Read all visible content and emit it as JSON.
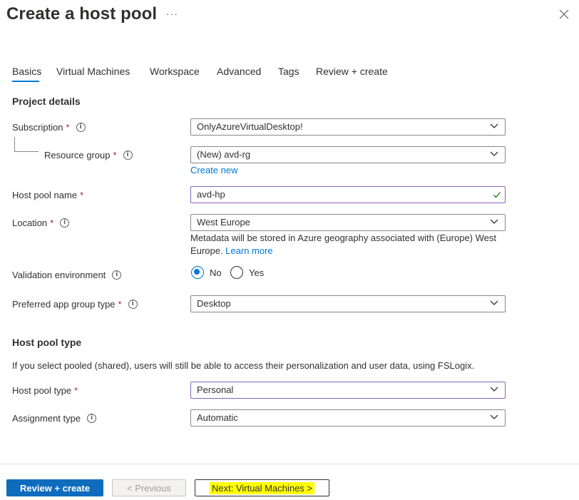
{
  "header": {
    "title": "Create a host pool",
    "more": "···"
  },
  "tabs": [
    "Basics",
    "Virtual Machines",
    "Workspace",
    "Advanced",
    "Tags",
    "Review + create"
  ],
  "project_details": {
    "heading": "Project details",
    "subscription": {
      "label": "Subscription",
      "value": "OnlyAzureVirtualDesktop!"
    },
    "resource_group": {
      "label": "Resource group",
      "value": "(New) avd-rg",
      "create_new": "Create new"
    },
    "host_pool_name": {
      "label": "Host pool name",
      "value": "avd-hp"
    },
    "location": {
      "label": "Location",
      "value": "West Europe",
      "help": "Metadata will be stored in Azure geography associated with (Europe) West Europe.",
      "learn_more": "Learn more"
    },
    "validation": {
      "label": "Validation environment",
      "options": [
        "No",
        "Yes"
      ],
      "selected": "No"
    },
    "app_group": {
      "label": "Preferred app group type",
      "value": "Desktop"
    }
  },
  "host_pool_type_section": {
    "heading": "Host pool type",
    "description": "If you select pooled (shared), users will still be able to access their personalization and user data, using FSLogix.",
    "host_pool_type": {
      "label": "Host pool type",
      "value": "Personal"
    },
    "assignment_type": {
      "label": "Assignment type",
      "value": "Automatic"
    }
  },
  "required_mark": "*",
  "footer": {
    "review_create": "Review + create",
    "previous": "< Previous",
    "next": "Next: Virtual Machines >"
  },
  "colors": {
    "accent": "#0078d4",
    "primary_button": "#0f6cbd",
    "required": "#a4262c",
    "highlight": "#ffff00",
    "success": "#107c10"
  }
}
